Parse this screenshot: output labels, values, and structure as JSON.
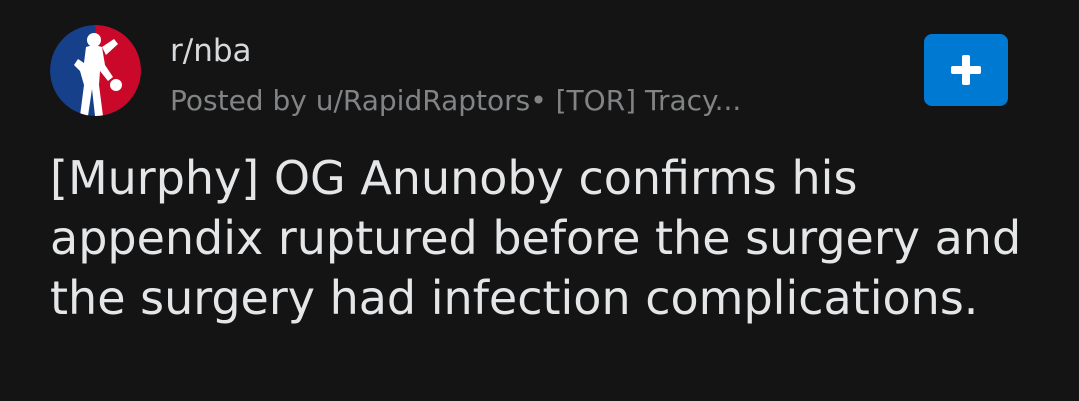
{
  "post": {
    "subreddit": "r/nba",
    "byline": "Posted by u/RapidRaptors• [TOR] Tracy...",
    "title": "[Murphy] OG Anunoby confirms his appendix ruptured before the surgery and the surgery had infection complications."
  },
  "icons": {
    "avatar": "nba-logo-icon",
    "join": "plus-icon"
  },
  "colors": {
    "background": "#141415",
    "accent": "#0079d3",
    "logo_red": "#c9082a",
    "logo_blue": "#17408b",
    "text_primary": "#d7dadc",
    "text_secondary": "#818384"
  }
}
